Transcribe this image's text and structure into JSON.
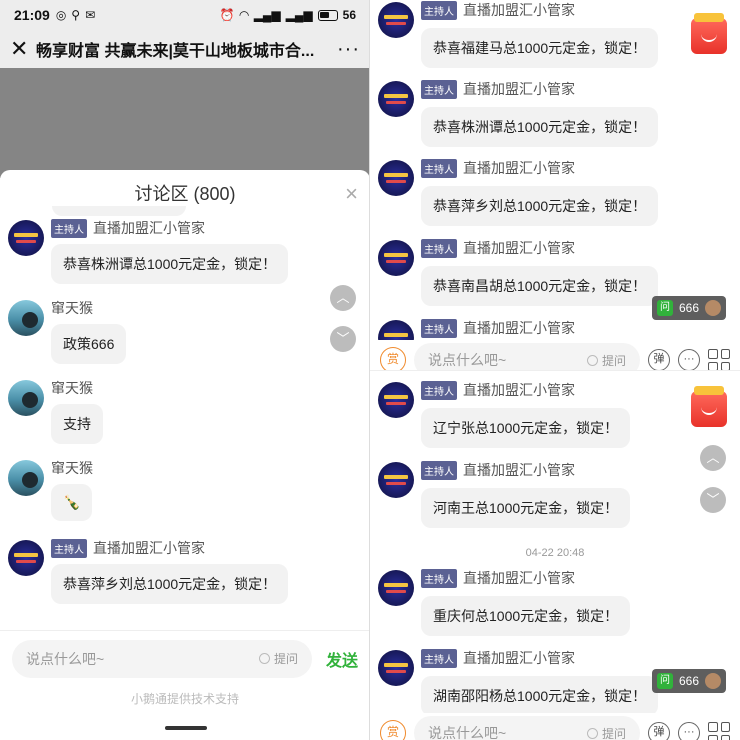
{
  "status_bar": {
    "time": "21:09",
    "left_icons": [
      "notification-icon",
      "person-icon",
      "mail-icon"
    ],
    "right_icons": [
      "alarm-icon",
      "wifi-icon",
      "signal-icon",
      "signal-icon",
      "nfc-icon",
      "battery-icon"
    ],
    "battery": "56"
  },
  "titlebar": {
    "title": "畅享财富 共赢未来|莫干山地板城市合...",
    "more": "···"
  },
  "sheet": {
    "title": "讨论区 (800)",
    "close": "×"
  },
  "left_messages": [
    {
      "host": true,
      "tag": "主持人",
      "name": "直播加盟汇小管家",
      "text": "恭喜株洲谭总1000元定金，锁定！"
    },
    {
      "host": false,
      "tag": "",
      "name": "窜天猴",
      "text": "政策666"
    },
    {
      "host": false,
      "tag": "",
      "name": "窜天猴",
      "text": "支持"
    },
    {
      "host": false,
      "tag": "",
      "name": "窜天猴",
      "text": "🍾"
    },
    {
      "host": true,
      "tag": "主持人",
      "name": "直播加盟汇小管家",
      "text": "恭喜萍乡刘总1000元定金，锁定！"
    }
  ],
  "left_input": {
    "placeholder": "说点什么吧~",
    "ask": "提问",
    "send": "发送"
  },
  "powered_by": "小鹅通提供技术支持",
  "right_top_messages": [
    {
      "tag": "主持人",
      "name": "直播加盟汇小管家",
      "text": "恭喜福建马总1000元定金，锁定！"
    },
    {
      "tag": "主持人",
      "name": "直播加盟汇小管家",
      "text": "恭喜株洲谭总1000元定金，锁定！"
    },
    {
      "tag": "主持人",
      "name": "直播加盟汇小管家",
      "text": "恭喜萍乡刘总1000元定金，锁定！"
    },
    {
      "tag": "主持人",
      "name": "直播加盟汇小管家",
      "text": "恭喜南昌胡总1000元定金，锁定！"
    },
    {
      "tag": "主持人",
      "name": "直播加盟汇小管家",
      "text": ""
    }
  ],
  "right_bot_messages": [
    {
      "tag": "主持人",
      "name": "直播加盟汇小管家",
      "text": "辽宁张总1000元定金，锁定！"
    },
    {
      "tag": "主持人",
      "name": "直播加盟汇小管家",
      "text": "河南王总1000元定金，锁定！"
    },
    {
      "tag": "主持人",
      "name": "直播加盟汇小管家",
      "text": "重庆何总1000元定金，锁定！"
    },
    {
      "tag": "主持人",
      "name": "直播加盟汇小管家",
      "text": "湖南邵阳杨总1000元定金，锁定！"
    }
  ],
  "timestamp": "04-22 20:48",
  "qa_pill": {
    "badge": "问",
    "count": "666"
  },
  "right_input": {
    "reward": "赏",
    "placeholder": "说点什么吧~",
    "ask": "提问",
    "barrage": "弹",
    "more": "···"
  },
  "colors": {
    "host_tag": "#5b6193",
    "send_green": "#31b23b",
    "reward_orange": "#f08b2e",
    "gift_red": "#e8322a"
  }
}
